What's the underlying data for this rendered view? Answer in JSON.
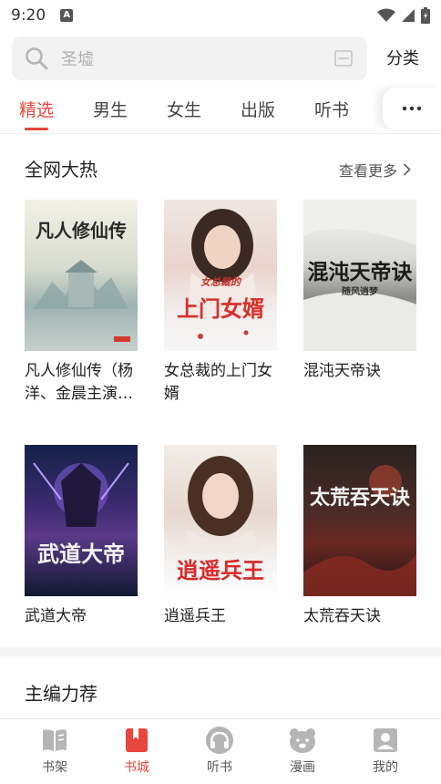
{
  "status_bar": {
    "time": "9:20",
    "notification_badge": "A"
  },
  "search": {
    "placeholder": "圣墟",
    "category_label": "分类"
  },
  "tabs": [
    {
      "label": "精选",
      "active": true
    },
    {
      "label": "男生",
      "active": false
    },
    {
      "label": "女生",
      "active": false
    },
    {
      "label": "出版",
      "active": false
    },
    {
      "label": "听书",
      "active": false
    }
  ],
  "sections": {
    "hot": {
      "title": "全网大热",
      "more_label": "查看更多"
    },
    "editor": {
      "title": "主编力荐"
    }
  },
  "books": [
    {
      "title": "凡人修仙传（杨洋、金晨主演…",
      "cover_text": "凡人修仙传"
    },
    {
      "title": "女总裁的上门女婿",
      "cover_text": "上门女婿",
      "cover_subtext": "女总裁的"
    },
    {
      "title": "混沌天帝诀",
      "cover_text": "混沌天帝诀",
      "cover_subtext": "随风逍梦"
    },
    {
      "title": "武道大帝",
      "cover_text": "武道大帝"
    },
    {
      "title": "逍遥兵王",
      "cover_text": "逍遥兵王"
    },
    {
      "title": "太荒吞天诀",
      "cover_text": "太荒吞天诀"
    }
  ],
  "bottom_nav": [
    {
      "label": "书架",
      "icon": "bookshelf-icon",
      "active": false
    },
    {
      "label": "书城",
      "icon": "bookstore-icon",
      "active": true
    },
    {
      "label": "听书",
      "icon": "headphones-icon",
      "active": false
    },
    {
      "label": "漫画",
      "icon": "comic-bear-icon",
      "active": false
    },
    {
      "label": "我的",
      "icon": "profile-icon",
      "active": false
    }
  ],
  "colors": {
    "accent": "#e8473d",
    "inactive_icon": "#b5b5b5"
  }
}
